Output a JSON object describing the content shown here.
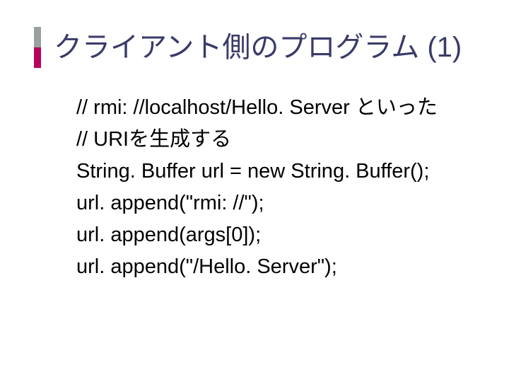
{
  "title": "クライアント側のプログラム (1)",
  "code": {
    "l1": "// rmi: //localhost/Hello. Server といった",
    "l2": "// URIを生成する",
    "l3": "String. Buffer url = new String. Buffer();",
    "l4": "url. append(\"rmi: //\");",
    "l5": "url. append(args[0]);",
    "l6": "url. append(\"/Hello. Server\");"
  }
}
